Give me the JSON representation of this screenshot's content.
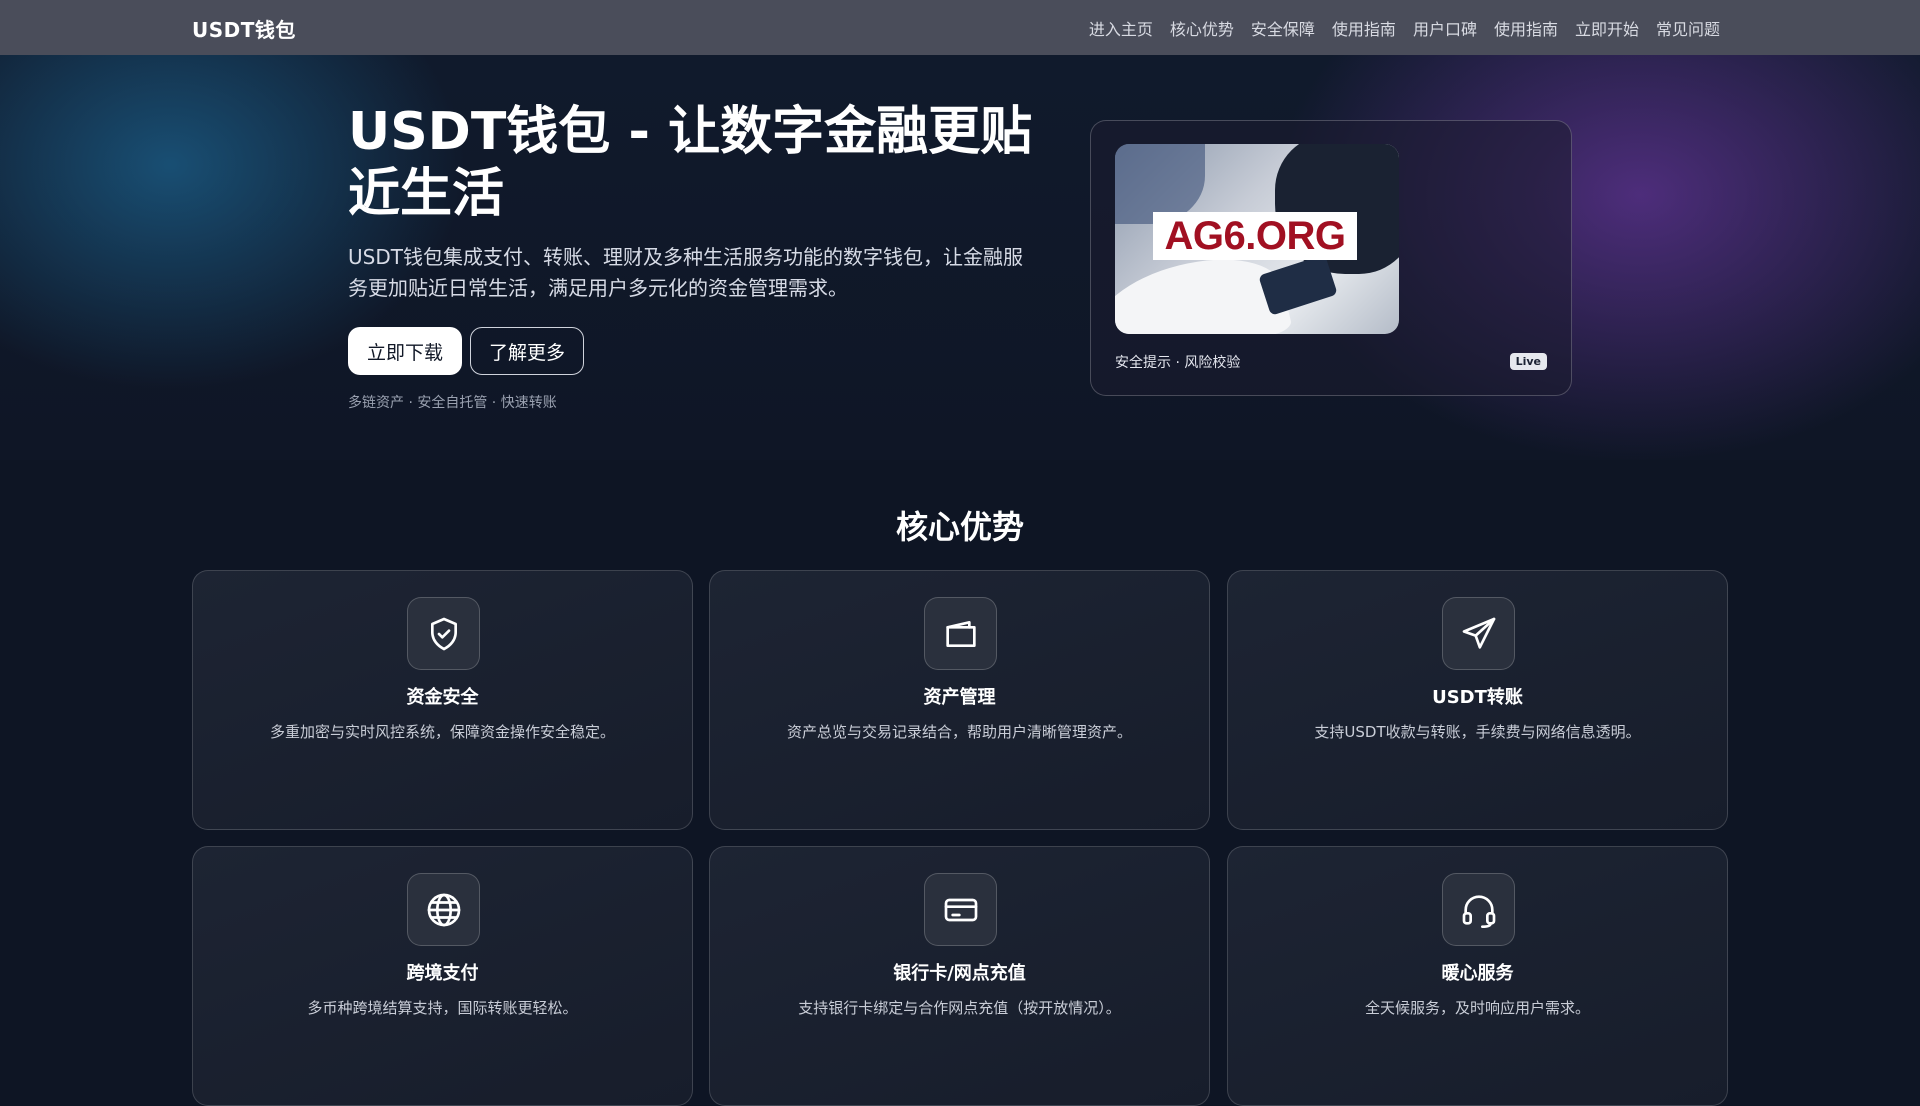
{
  "nav": {
    "brand": "USDT钱包",
    "links": [
      "进入主页",
      "核心优势",
      "安全保障",
      "使用指南",
      "用户口碑",
      "使用指南",
      "立即开始",
      "常见问题"
    ]
  },
  "hero": {
    "title": "USDT钱包 - 让数字金融更贴近生活",
    "description": "USDT钱包集成支付、转账、理财及多种生活服务功能的数字钱包，让金融服务更加贴近日常生活，满足用户多元化的资金管理需求。",
    "primary_button": "立即下载",
    "secondary_button": "了解更多",
    "tags": "多链资产 · 安全自托管 · 快速转账",
    "card": {
      "image_label": "AG6.ORG",
      "caption": "安全提示 · 风险校验",
      "badge": "Live"
    }
  },
  "features": {
    "title": "核心优势",
    "items": [
      {
        "icon": "shield-icon",
        "title": "资金安全",
        "desc": "多重加密与实时风控系统，保障资金操作安全稳定。"
      },
      {
        "icon": "wallet-icon",
        "title": "资产管理",
        "desc": "资产总览与交易记录结合，帮助用户清晰管理资产。"
      },
      {
        "icon": "send-icon",
        "title": "USDT转账",
        "desc": "支持USDT收款与转账，手续费与网络信息透明。"
      },
      {
        "icon": "globe-icon",
        "title": "跨境支付",
        "desc": "多币种跨境结算支持，国际转账更轻松。"
      },
      {
        "icon": "card-icon",
        "title": "银行卡/网点充值",
        "desc": "支持银行卡绑定与合作网点充值（按开放情况）。"
      },
      {
        "icon": "headset-icon",
        "title": "暖心服务",
        "desc": "全天候服务，及时响应用户需求。"
      }
    ]
  },
  "colors": {
    "nav_bg": "#4a4d5a",
    "page_bg": "#0e1524",
    "card_bg": "#1d2433",
    "accent_red": "#a11022"
  }
}
